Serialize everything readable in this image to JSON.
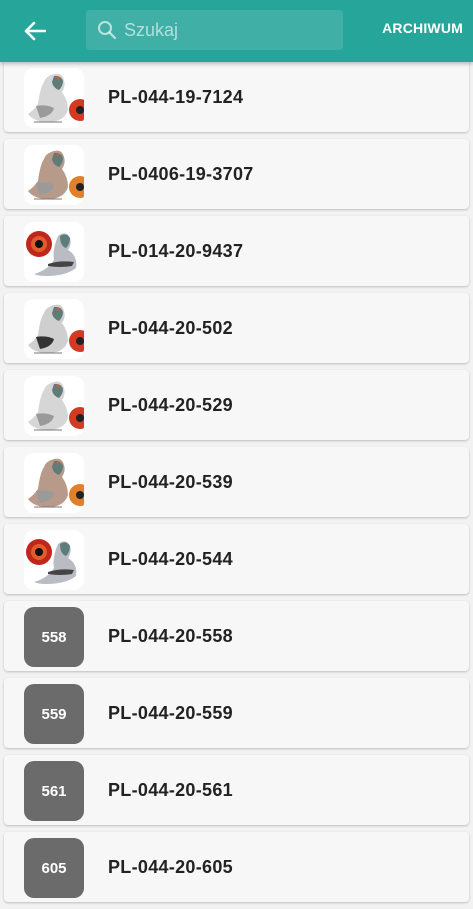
{
  "header": {
    "search_placeholder": "Szukaj",
    "archive_label": "ARCHIWUM",
    "color": "#26a69a"
  },
  "pigeons": [
    {
      "ring": "PL-044-19-7124",
      "thumb": "photo",
      "variant": "grey-eye-right"
    },
    {
      "ring": "PL-0406-19-3707",
      "thumb": "photo",
      "variant": "red-eye-right"
    },
    {
      "ring": "PL-014-20-9437",
      "thumb": "photo",
      "variant": "eye-left"
    },
    {
      "ring": "PL-044-20-502",
      "thumb": "photo",
      "variant": "checker-eye-right"
    },
    {
      "ring": "PL-044-20-529",
      "thumb": "photo",
      "variant": "grey-eye-right"
    },
    {
      "ring": "PL-044-20-539",
      "thumb": "photo",
      "variant": "red-eye-right"
    },
    {
      "ring": "PL-044-20-544",
      "thumb": "photo",
      "variant": "eye-left"
    },
    {
      "ring": "PL-044-20-558",
      "thumb": "number",
      "badge": "558"
    },
    {
      "ring": "PL-044-20-559",
      "thumb": "number",
      "badge": "559"
    },
    {
      "ring": "PL-044-20-561",
      "thumb": "number",
      "badge": "561"
    },
    {
      "ring": "PL-044-20-605",
      "thumb": "number",
      "badge": "605"
    }
  ]
}
